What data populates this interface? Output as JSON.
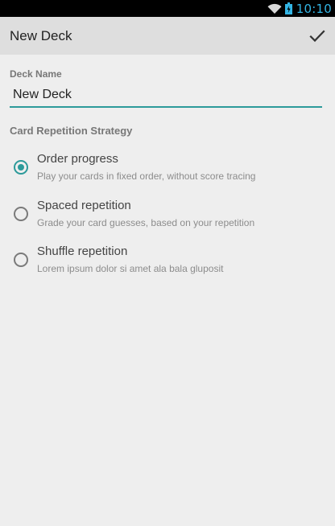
{
  "status_bar": {
    "time": "10:10",
    "icons": [
      "wifi-icon",
      "battery-icon"
    ]
  },
  "action_bar": {
    "title": "New Deck",
    "confirm_icon": "checkmark-icon"
  },
  "form": {
    "deck_name_label": "Deck Name",
    "deck_name_value": "New Deck",
    "strategy_label": "Card Repetition Strategy",
    "options": [
      {
        "title": "Order progress",
        "description": "Play your cards in fixed order, without score tracing",
        "selected": true
      },
      {
        "title": "Spaced repetition",
        "description": "Grade your card guesses, based on your repetition",
        "selected": false
      },
      {
        "title": "Shuffle repetition",
        "description": "Lorem ipsum dolor si amet ala bala gluposit",
        "selected": false
      }
    ]
  },
  "colors": {
    "accent": "#2c9a9a",
    "clock": "#33b5e5",
    "action_bar": "#dedede",
    "background": "#eeeeee"
  }
}
